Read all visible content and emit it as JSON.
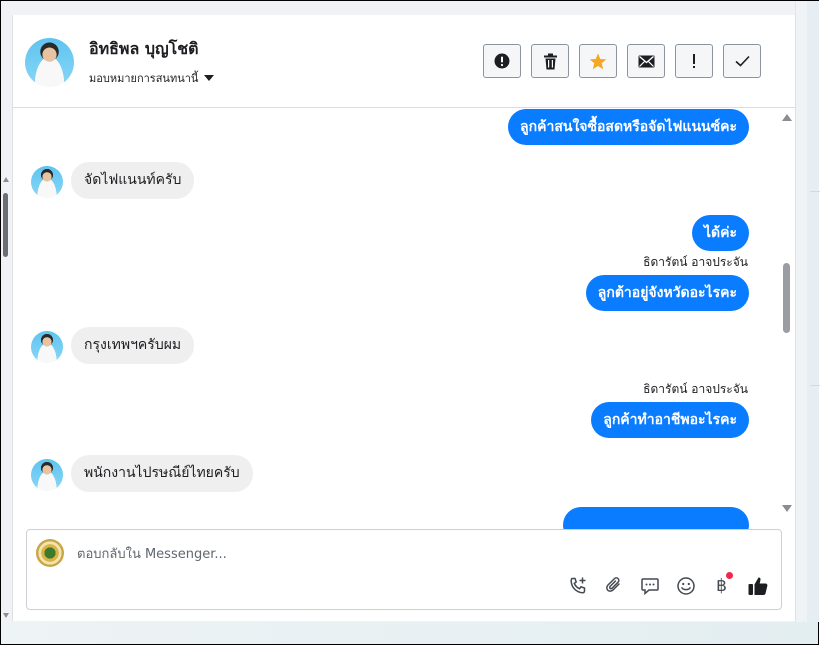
{
  "header": {
    "contact_name": "อิทธิพล บุญโชติ",
    "assignment": "มอบหมายการสนทนานี้"
  },
  "toolbar": [
    {
      "name": "report-button",
      "icon": "exclamation-circle-icon"
    },
    {
      "name": "delete-button",
      "icon": "trash-icon"
    },
    {
      "name": "star-button",
      "icon": "star-icon"
    },
    {
      "name": "mark-unread-button",
      "icon": "envelope-icon"
    },
    {
      "name": "important-button",
      "icon": "exclamation-icon"
    },
    {
      "name": "done-button",
      "icon": "check-icon"
    }
  ],
  "messages": [
    {
      "from": "page",
      "text": "ลูกค้าสนใจซื้อสดหรือจัดไฟแนนซ์คะ"
    },
    {
      "from": "customer",
      "text": "จัดไฟแนนท์ครับ"
    },
    {
      "from": "page",
      "text": "ได้ค่ะ"
    },
    {
      "from": "page",
      "sender": "ธิดารัตน์ อาจประจัน",
      "text": "ลูกต้าอยู่จังหวัดอะไรคะ"
    },
    {
      "from": "customer",
      "text": "กรุงเทพฯครับผม"
    },
    {
      "from": "page",
      "sender": "ธิดารัตน์ อาจประจัน",
      "text": "ลูกค้าทำอาชีพอะไรคะ"
    },
    {
      "from": "customer",
      "text": "พนักงานไปรษณีย์ไทยครับ"
    }
  ],
  "composer": {
    "placeholder": "ตอบกลับใน Messenger...",
    "tools": [
      "phone-plus-icon",
      "paperclip-icon",
      "chat-bubble-icon",
      "smiley-icon",
      "baht-icon",
      "thumbs-up-icon"
    ],
    "baht_symbol": "฿"
  },
  "colors": {
    "outgoing_bubble": "#0a7cff",
    "incoming_bubble": "#efefef",
    "star": "#f5a623",
    "notification_dot": "#f02849"
  }
}
